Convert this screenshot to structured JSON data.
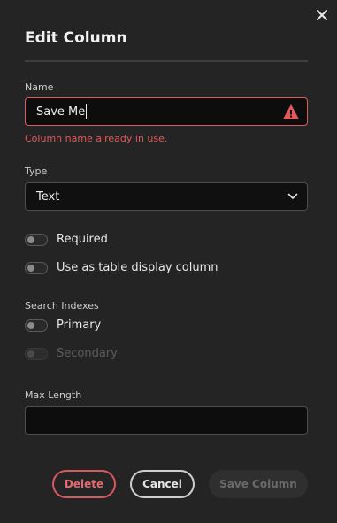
{
  "dialog": {
    "title": "Edit Column",
    "close_icon": "close-icon"
  },
  "name_field": {
    "label": "Name",
    "value": "Save Me",
    "error": "Column name already in use.",
    "error_icon": "warning-icon",
    "error_color": "#e05a5a"
  },
  "type_field": {
    "label": "Type",
    "value": "Text",
    "icon": "chevron-down-icon"
  },
  "toggles": {
    "required": {
      "label": "Required",
      "on": false
    },
    "display_column": {
      "label": "Use as table display column",
      "on": false
    }
  },
  "search_indexes": {
    "label": "Search Indexes",
    "primary": {
      "label": "Primary",
      "on": false,
      "enabled": true
    },
    "secondary": {
      "label": "Secondary",
      "on": false,
      "enabled": false
    }
  },
  "max_length": {
    "label": "Max Length",
    "value": ""
  },
  "buttons": {
    "delete": "Delete",
    "cancel": "Cancel",
    "save": "Save Column"
  },
  "colors": {
    "background": "#242424",
    "input_bg": "#0d0d0d",
    "danger": "#d9595f"
  }
}
